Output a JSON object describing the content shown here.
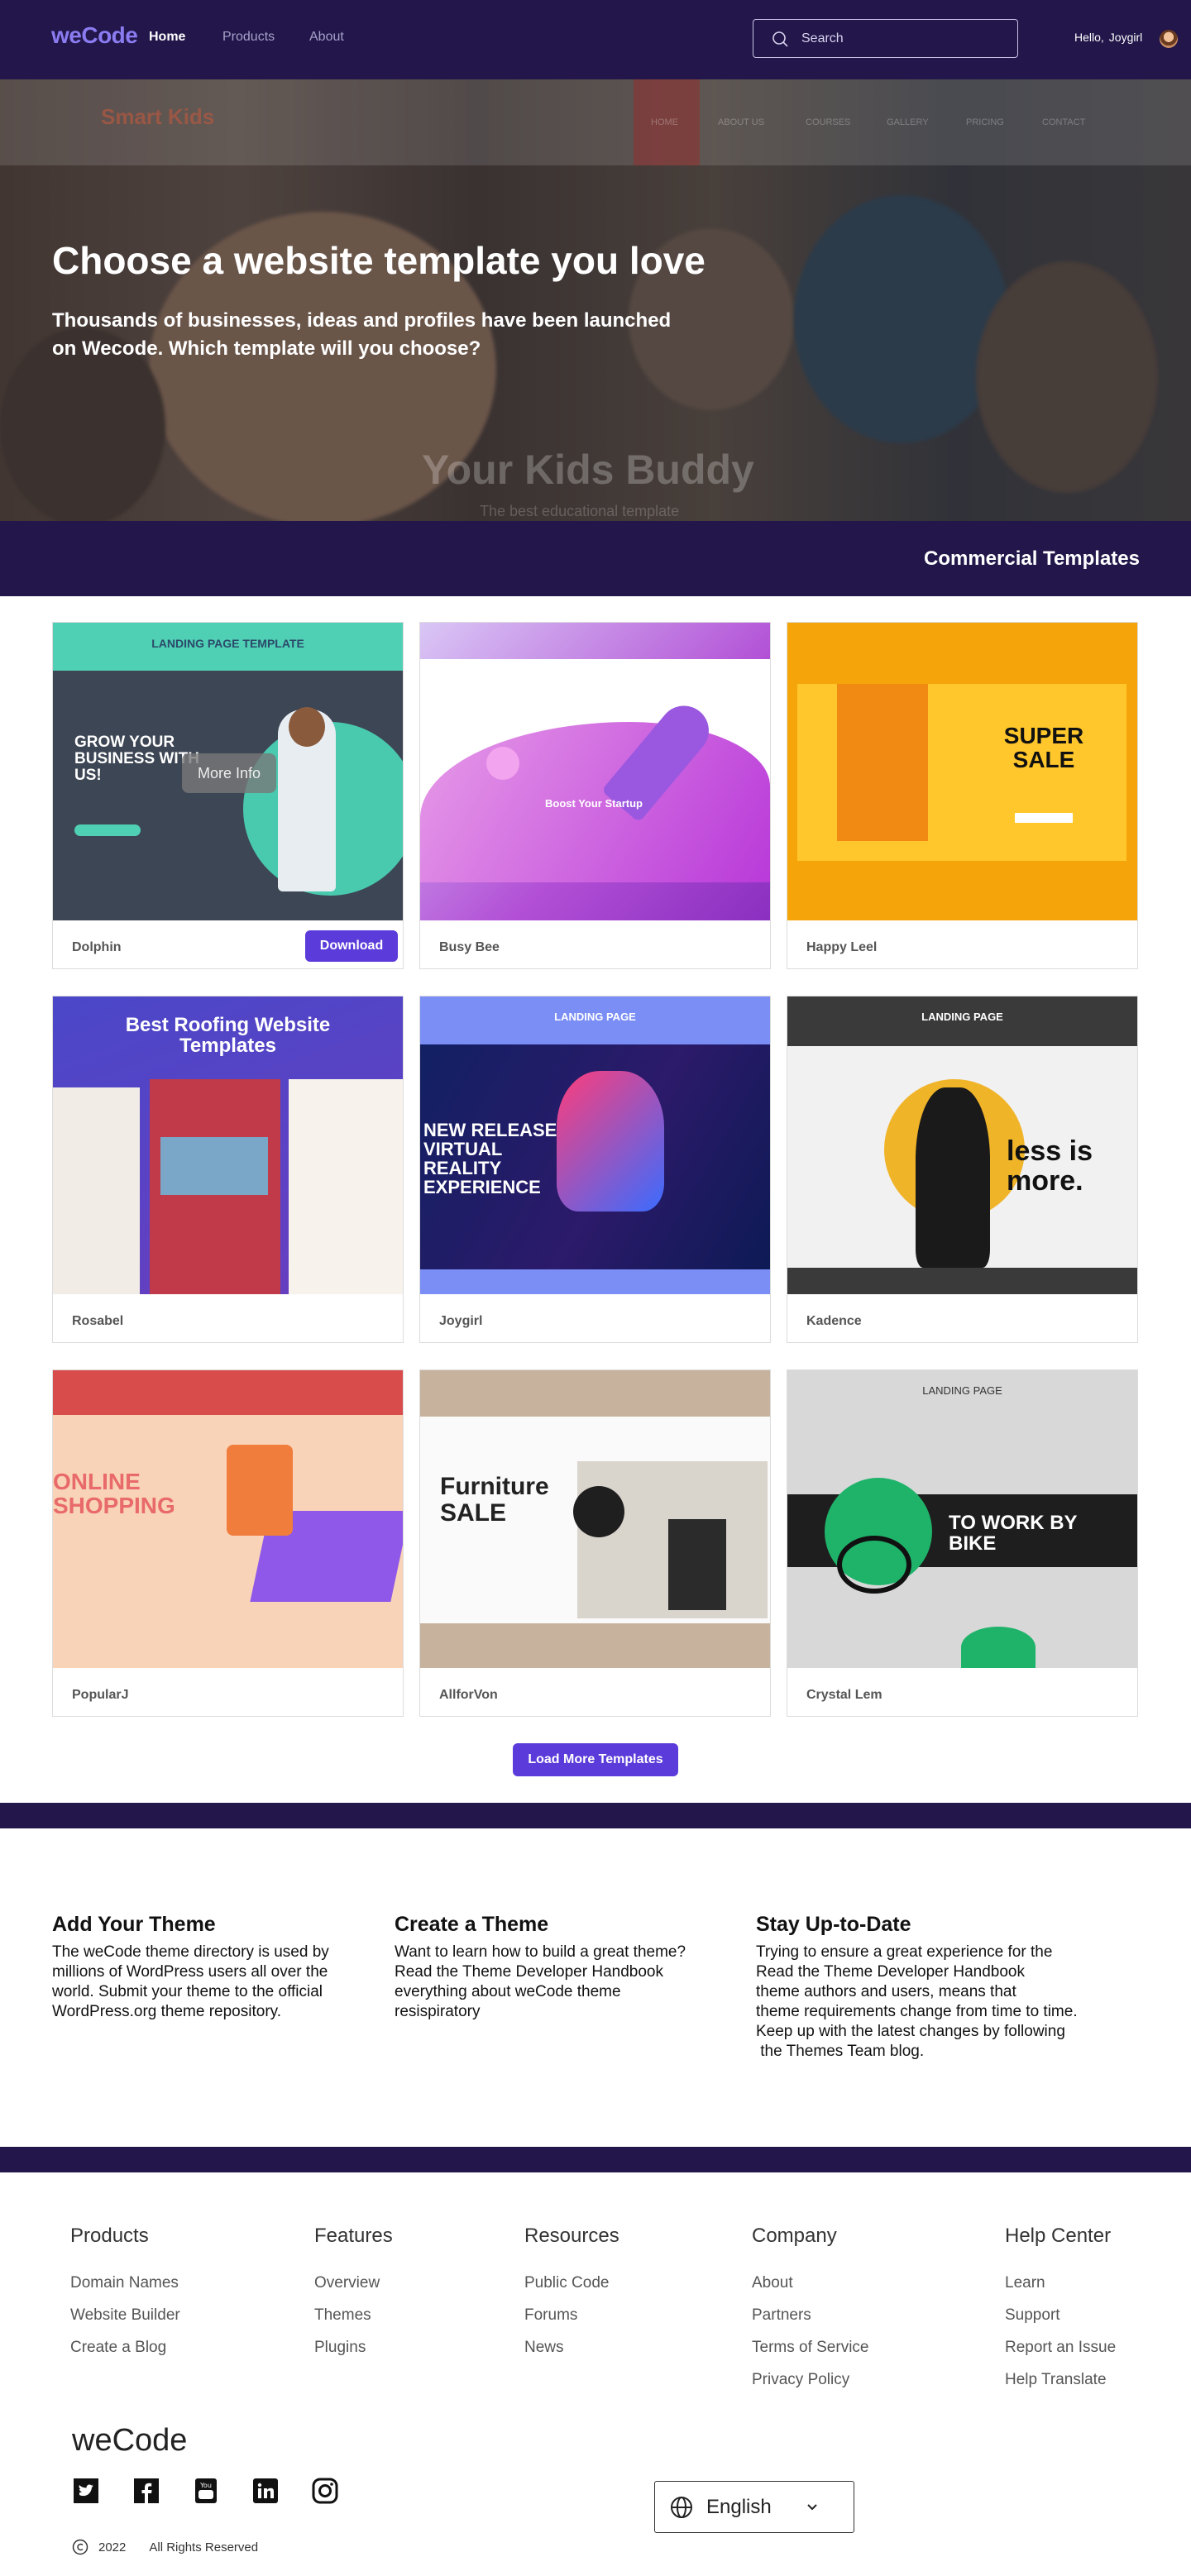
{
  "nav": {
    "logo": "weCode",
    "links": [
      "Home",
      "Products",
      "About"
    ],
    "search_placeholder": "Search",
    "greeting": "Hello,",
    "username": "Joygirl"
  },
  "hero": {
    "title": "Choose a website template you love",
    "subtitle": "Thousands of businesses, ideas and profiles have been launched on Wecode. Which template will you choose?",
    "bg_logo": "Smart Kids",
    "bg_menu": [
      "HOME",
      "ABOUT US",
      "COURSES",
      "GALLERY",
      "PRICING",
      "CONTACT"
    ],
    "bg_headline": "Your Kids Buddy",
    "bg_subline": "The best educational template"
  },
  "section_title": "Commercial Templates",
  "templates": [
    {
      "name": "Dolphin",
      "download_label": "Download",
      "more_info_label": "More Info",
      "thumb_title": "LANDING PAGE TEMPLATE",
      "thumb_text": "GROW YOUR BUSINESS WITH US!"
    },
    {
      "name": "Busy Bee",
      "thumb_text": "Boost Your Startup"
    },
    {
      "name": "Happy Leel",
      "thumb_text": "SUPER SALE"
    },
    {
      "name": "Rosabel",
      "thumb_text": "Best Roofing Website Templates"
    },
    {
      "name": "Joygirl",
      "thumb_title": "LANDING PAGE",
      "thumb_text": "NEW RELEASE VIRTUAL REALITY EXPERIENCE"
    },
    {
      "name": "Kadence",
      "thumb_title": "LANDING PAGE",
      "thumb_text": "less is more."
    },
    {
      "name": "PopularJ",
      "thumb_text": "ONLINE SHOPPING"
    },
    {
      "name": "AllforVon",
      "thumb_text": "Furniture SALE"
    },
    {
      "name": "Crystal Lem",
      "thumb_title": "LANDING PAGE",
      "thumb_text": "TO WORK BY BIKE"
    }
  ],
  "load_more": "Load More Templates",
  "info": [
    {
      "title": "Add Your Theme",
      "lines": [
        "The weCode theme directory is used by",
        "millions of WordPress users all over the",
        "world. Submit your theme to the official",
        "WordPress.org theme repository."
      ]
    },
    {
      "title": "Create a Theme",
      "lines": [
        "Want to learn how to build a great theme?",
        "Read the Theme Developer Handbook",
        "everything about weCode theme",
        "resispiratory"
      ]
    },
    {
      "title": "Stay Up-to-Date",
      "lines": [
        "Trying to ensure a great experience for the",
        "Read the Theme Developer Handbook",
        "theme authors and users, means that",
        "theme requirements change from time to time.",
        "Keep up with the latest changes by following",
        " the Themes Team blog."
      ]
    }
  ],
  "footer": {
    "columns": [
      {
        "title": "Products",
        "links": [
          "Domain Names",
          "Website Builder",
          "Create a Blog"
        ]
      },
      {
        "title": "Features",
        "links": [
          "Overview",
          "Themes",
          "Plugins"
        ]
      },
      {
        "title": "Resources",
        "links": [
          "Public Code",
          "Forums",
          "News"
        ]
      },
      {
        "title": "Company",
        "links": [
          "About",
          "Partners",
          "Terms of Service",
          "Privacy Policy"
        ]
      },
      {
        "title": "Help Center",
        "links": [
          "Learn",
          "Support",
          "Report an Issue",
          "Help Translate"
        ]
      }
    ],
    "logo": "weCode",
    "social": [
      "twitter-icon",
      "facebook-icon",
      "youtube-icon",
      "linkedin-icon",
      "instagram-icon"
    ],
    "language": "English",
    "year": "2022",
    "rights": "All Rights Reserved"
  },
  "colors": {
    "brand_dark": "#22164a",
    "accent": "#5b3bd9",
    "logo": "#8a7cf0"
  }
}
